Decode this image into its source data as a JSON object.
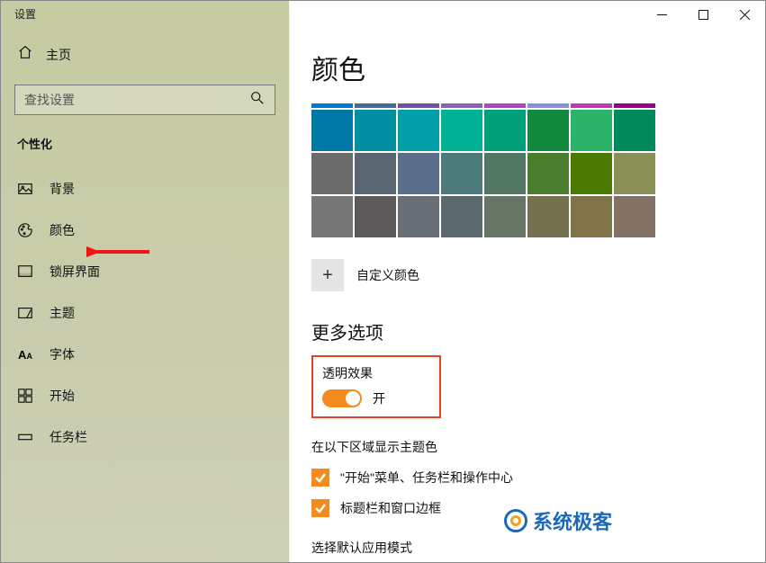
{
  "window": {
    "title": "设置"
  },
  "sidebar": {
    "home": "主页",
    "searchPlaceholder": "查找设置",
    "sectionHeader": "个性化",
    "items": [
      {
        "label": "背景"
      },
      {
        "label": "颜色"
      },
      {
        "label": "锁屏界面"
      },
      {
        "label": "主题"
      },
      {
        "label": "字体"
      },
      {
        "label": "开始"
      },
      {
        "label": "任务栏"
      }
    ]
  },
  "page": {
    "title": "颜色",
    "thinRow": [
      "#0078d7",
      "#486993",
      "#744da9",
      "#8764b8",
      "#b146c2",
      "#8a8fdb",
      "#c239b3",
      "#9a0089"
    ],
    "colors": [
      [
        "#0078a5",
        "#008ea0",
        "#009faa",
        "#00b294",
        "#00a078",
        "#10893e",
        "#2bb36a",
        "#008a5b"
      ],
      [
        "#6b6b6b",
        "#5a6572",
        "#5a6e8c",
        "#4d7b7b",
        "#527865",
        "#4a7d2c",
        "#4a7a00",
        "#8a8f57"
      ],
      [
        "#767676",
        "#5b595a",
        "#696e77",
        "#5a6a6c",
        "#677566",
        "#747151",
        "#7f7347",
        "#827265"
      ]
    ],
    "customColorLabel": "自定义颜色",
    "moreHeader": "更多选项",
    "transparency": {
      "label": "透明效果",
      "state": "开"
    },
    "accentAreaHeader": "在以下区域显示主题色",
    "checks": [
      {
        "label": "\"开始\"菜单、任务栏和操作中心"
      },
      {
        "label": "标题栏和窗口边框"
      }
    ],
    "appModeHeader": "选择默认应用模式"
  },
  "watermark": "系统极客"
}
